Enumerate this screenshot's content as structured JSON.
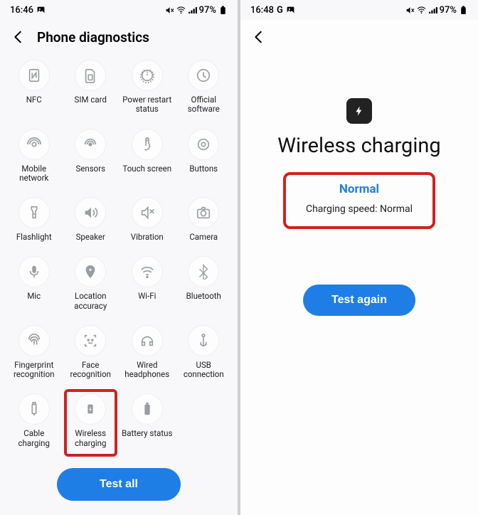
{
  "left": {
    "status": {
      "time": "16:46",
      "battery": "97%"
    },
    "header": {
      "title": "Phone diagnostics"
    },
    "tiles": [
      {
        "label": "NFC",
        "id": "nfc"
      },
      {
        "label": "SIM card",
        "id": "sim"
      },
      {
        "label": "Power restart status",
        "id": "power"
      },
      {
        "label": "Official software",
        "id": "software"
      },
      {
        "label": "Mobile network",
        "id": "mobile"
      },
      {
        "label": "Sensors",
        "id": "sensors"
      },
      {
        "label": "Touch screen",
        "id": "touch"
      },
      {
        "label": "Buttons",
        "id": "buttons"
      },
      {
        "label": "Flashlight",
        "id": "flashlight"
      },
      {
        "label": "Speaker",
        "id": "speaker"
      },
      {
        "label": "Vibration",
        "id": "vibration"
      },
      {
        "label": "Camera",
        "id": "camera"
      },
      {
        "label": "Mic",
        "id": "mic"
      },
      {
        "label": "Location accuracy",
        "id": "location"
      },
      {
        "label": "Wi-Fi",
        "id": "wifi"
      },
      {
        "label": "Bluetooth",
        "id": "bluetooth"
      },
      {
        "label": "Fingerprint recognition",
        "id": "fingerprint"
      },
      {
        "label": "Face recognition",
        "id": "face"
      },
      {
        "label": "Wired headphones",
        "id": "headphones"
      },
      {
        "label": "USB connection",
        "id": "usb"
      },
      {
        "label": "Cable charging",
        "id": "cable"
      },
      {
        "label": "Wireless charging",
        "id": "wireless",
        "highlight": true
      },
      {
        "label": "Battery status",
        "id": "battery"
      }
    ],
    "button": "Test all"
  },
  "right": {
    "status": {
      "time": "16:48",
      "apps": "G",
      "battery": "97%"
    },
    "result": {
      "title": "Wireless charging",
      "status": "Normal",
      "detail": "Charging speed: Normal"
    },
    "button": "Test again"
  }
}
